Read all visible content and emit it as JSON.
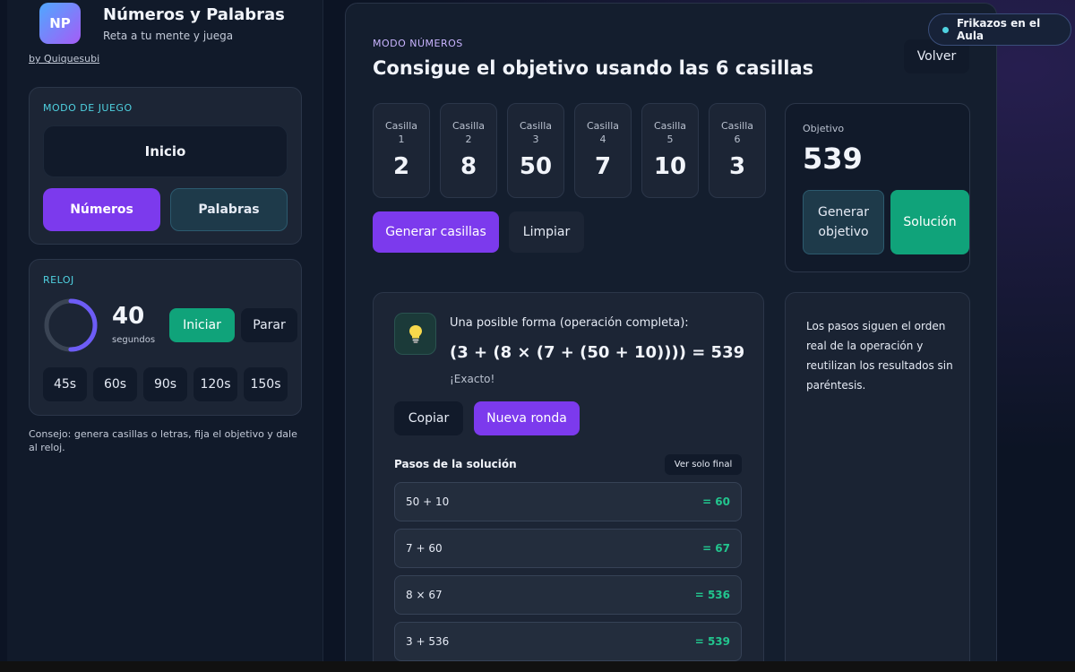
{
  "app": {
    "logo_text": "NP",
    "title": "Números y Palabras",
    "subtitle": "Reta a tu mente y juega",
    "author": "by Quiquesubi"
  },
  "badge": {
    "label": "Frikazos en el Aula"
  },
  "sidebar": {
    "mode": {
      "label": "MODO DE JUEGO",
      "inicio": "Inicio",
      "numeros": "Números",
      "palabras": "Palabras"
    },
    "clock": {
      "label": "RELOJ",
      "seconds": "40",
      "seconds_label": "segundos",
      "progress_fraction": 0.5,
      "start": "Iniciar",
      "stop": "Parar",
      "times": [
        "45s",
        "60s",
        "90s",
        "120s",
        "150s"
      ]
    },
    "tip": "Consejo: genera casillas o letras, fija el objetivo y dale al reloj."
  },
  "main": {
    "mode_tag": "MODO NÚMEROS",
    "headline": "Consigue el objetivo usando las 6 casillas",
    "back": "Volver",
    "tiles": [
      {
        "label": "Casilla 1",
        "value": "2"
      },
      {
        "label": "Casilla 2",
        "value": "8"
      },
      {
        "label": "Casilla 3",
        "value": "50"
      },
      {
        "label": "Casilla 4",
        "value": "7"
      },
      {
        "label": "Casilla 5",
        "value": "10"
      },
      {
        "label": "Casilla 6",
        "value": "3"
      }
    ],
    "generate_tiles": "Generar casillas",
    "clear": "Limpiar",
    "target": {
      "label": "Objetivo",
      "value": "539",
      "generate": "Generar objetivo",
      "solution": "Solución"
    },
    "solution": {
      "intro": "Una posible forma (operación completa):",
      "expression": "(3 + (8 × (7 + (50 + 10)))) = 539",
      "status": "¡Exacto!",
      "copy": "Copiar",
      "new_round": "Nueva ronda",
      "steps_title": "Pasos de la solución",
      "final_only": "Ver solo final",
      "steps": [
        {
          "op": "50 + 10",
          "result": "= 60"
        },
        {
          "op": "7 + 60",
          "result": "= 67"
        },
        {
          "op": "8 × 67",
          "result": "= 536"
        },
        {
          "op": "3 + 536",
          "result": "= 539"
        }
      ]
    },
    "notes": "Los pasos siguen el orden real de la operación y reutilizan los resultados sin paréntesis."
  }
}
